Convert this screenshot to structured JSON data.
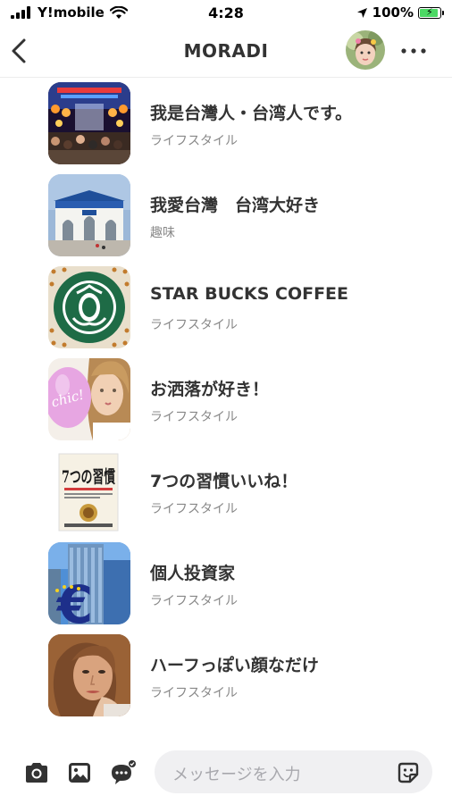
{
  "status_bar": {
    "carrier": "Y!mobile",
    "time": "4:28",
    "battery": "100%",
    "battery_level": 1.0
  },
  "header": {
    "title": "MORADI",
    "back_icon": "chevron-left-icon",
    "more_icon": "ellipsis-icon"
  },
  "groups": [
    {
      "title": "我是台灣人・台湾人です。",
      "category": "ライフスタイル"
    },
    {
      "title": "我愛台灣　台湾大好き",
      "category": "趣味"
    },
    {
      "title": "STAR BUCKS COFFEE",
      "category": "ライフスタイル"
    },
    {
      "title": "お洒落が好き！",
      "category": "ライフスタイル"
    },
    {
      "title": "7つの習慣いいね！",
      "category": "ライフスタイル"
    },
    {
      "title": "個人投資家",
      "category": "ライフスタイル"
    },
    {
      "title": "ハーフっぽい顔なだけ",
      "category": "ライフスタイル"
    }
  ],
  "thumb_text": {
    "chic": "chic!",
    "book_title": "7つの習慣",
    "euro": "€"
  },
  "composer": {
    "placeholder": "メッセージを入力",
    "icons": [
      "camera-icon",
      "image-icon",
      "chat-bubble-icon",
      "sticker-icon"
    ]
  },
  "colors": {
    "text": "#333333",
    "subtext": "#888888",
    "input_bg": "#f0f0f2",
    "battery_green": "#4cd964"
  }
}
